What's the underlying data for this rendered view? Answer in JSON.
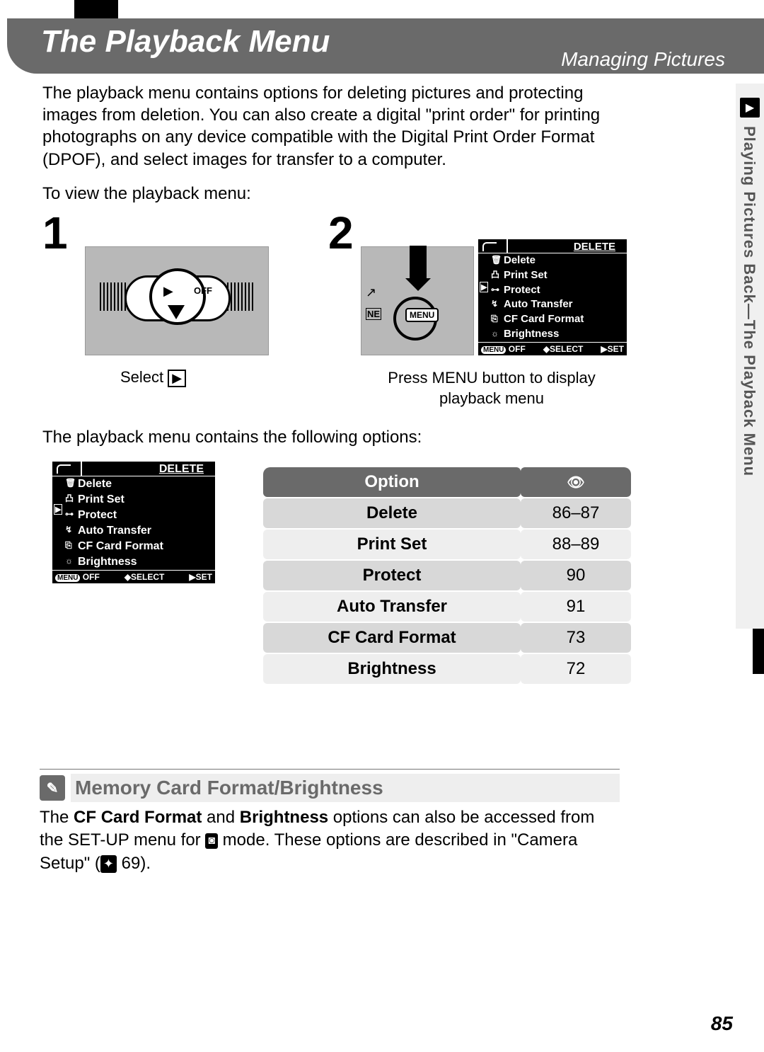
{
  "header": {
    "title": "The Playback Menu",
    "subtitle": "Managing Pictures"
  },
  "intro": {
    "p1": "The playback menu contains options for deleting pictures and protecting images from deletion.  You can also create a digital \"print order\" for printing photographs on any device compatible with the Digital Print Order Format (DPOF), and select images for transfer to a computer.",
    "p2": "To view the playback menu:",
    "p3": "The playback menu contains the following options:"
  },
  "steps": {
    "one": "1",
    "two": "2",
    "caption1_prefix": "Select ",
    "caption2": "Press MENU button to display playback menu",
    "menu_label": "MENU",
    "off_label": "OFF"
  },
  "mini_menu": {
    "title": "DELETE",
    "items": [
      {
        "icon": "🗑",
        "label": "Delete"
      },
      {
        "icon": "凸",
        "label": "Print Set"
      },
      {
        "icon": "⊶",
        "label": "Protect"
      },
      {
        "icon": "↯",
        "label": "Auto Transfer"
      },
      {
        "icon": "⎘",
        "label": "CF Card Format"
      },
      {
        "icon": "☼",
        "label": "Brightness"
      }
    ],
    "side_icon": "▶",
    "footer": {
      "off": "OFF",
      "select": "SELECT",
      "set": "SET",
      "menu": "MENU"
    }
  },
  "options_table": {
    "header_option": "Option",
    "header_page_icon": "📖",
    "rows": [
      {
        "label": "Delete",
        "pages": "86–87"
      },
      {
        "label": "Print Set",
        "pages": "88–89"
      },
      {
        "label": "Protect",
        "pages": "90"
      },
      {
        "label": "Auto Transfer",
        "pages": "91"
      },
      {
        "label": "CF Card Format",
        "pages": "73"
      },
      {
        "label": "Brightness",
        "pages": "72"
      }
    ]
  },
  "callout": {
    "heading": "Memory Card Format/Brightness",
    "body_1": "The ",
    "bold_1": "CF Card Format",
    "body_2": " and ",
    "bold_2": "Brightness",
    "body_3": " options can also be accessed from the SET-UP menu for ",
    "body_4": " mode.  These options are described in \"Camera Setup\" (",
    "pageref": " 69)."
  },
  "side_tab": "Playing Pictures Back—The Playback Menu",
  "page_number": "85"
}
